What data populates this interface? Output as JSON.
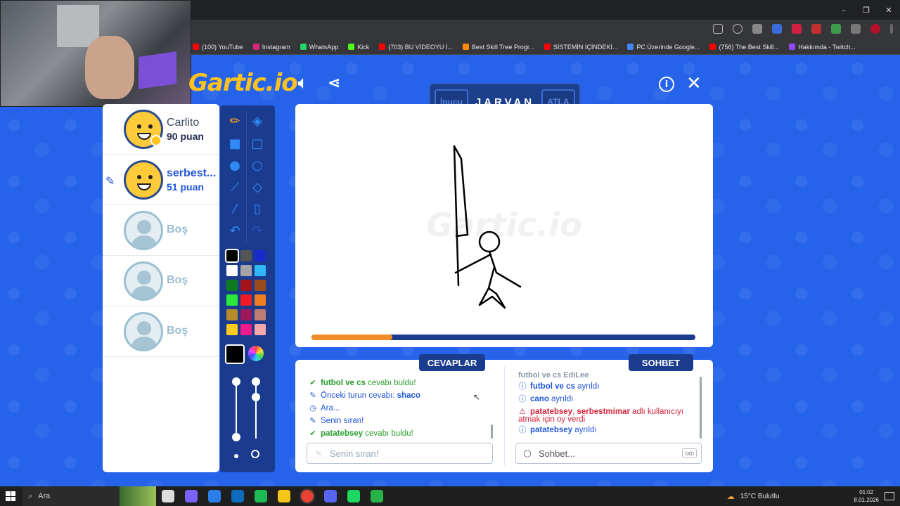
{
  "browser": {
    "window_controls": [
      "–",
      "❐",
      "✕"
    ],
    "bookmarks": [
      {
        "label": "(100) YouTube",
        "color": "#ff0000"
      },
      {
        "label": "Instagram",
        "color": "#d62976"
      },
      {
        "label": "WhatsApp",
        "color": "#25d366"
      },
      {
        "label": "Kick",
        "color": "#53fc18"
      },
      {
        "label": "(703) BU VİDEOYU İ...",
        "color": "#ff0000"
      },
      {
        "label": "Best Skill Tree Progr...",
        "color": "#ff8a00"
      },
      {
        "label": "SİSTEMİN İÇİNDEKİ...",
        "color": "#ff0000"
      },
      {
        "label": "PC Üzerinde Google...",
        "color": "#4285f4"
      },
      {
        "label": "(756) The Best Skill...",
        "color": "#ff0000"
      },
      {
        "label": "Hakkımda - Twitch...",
        "color": "#9146ff"
      }
    ]
  },
  "game": {
    "logo": "Gartic.io",
    "word_panel": {
      "hint_label": "İpucu",
      "word": "JARVAN",
      "skip_label": "ATLA"
    },
    "players": [
      {
        "name": "Carlito",
        "score": "90 puan",
        "active": false
      },
      {
        "name": "serbest...",
        "score": "51 puan",
        "active": true
      },
      {
        "name": "Boş"
      },
      {
        "name": "Boş"
      },
      {
        "name": "Boş"
      }
    ],
    "colors": [
      "#000000",
      "#555555",
      "#1a2bcc",
      "#ffffff",
      "#a5a5a5",
      "#2fb7f5",
      "#0e7a1e",
      "#a31319",
      "#9b4a1c",
      "#2be83b",
      "#ee1c24",
      "#ef7d21",
      "#b88a2b",
      "#a0165b",
      "#bd7d73",
      "#ffcb1f",
      "#f01a8c",
      "#f7a9a9"
    ],
    "selected_color": "#000000",
    "round_progress": 0.21,
    "answers": {
      "tab_label": "CEVAPLAR",
      "messages": [
        {
          "icon": "check-icon",
          "bold": "futbol ve cs",
          "text": " cevabı buldu!",
          "type": "green"
        },
        {
          "icon": "pencil-icon",
          "bold": "",
          "text": "Önceki turun cevabı: ",
          "tail": "shaco",
          "type": "blue"
        },
        {
          "icon": "clock-icon",
          "bold": "",
          "text": "Ara...",
          "type": "blue"
        },
        {
          "icon": "pencil-icon",
          "bold": "",
          "text": "Senin sıran!",
          "type": "blue"
        },
        {
          "icon": "check-icon",
          "bold": "patatebsey",
          "text": " cevabı buldu!",
          "type": "green"
        }
      ],
      "input_placeholder": "Senin sıran!"
    },
    "chat": {
      "tab_label": "SOHBET",
      "partial_line": "futbol ve cs EdiLee",
      "messages": [
        {
          "icon": "info-icon",
          "bold": "futbol ve cs",
          "text": " ayrıldı",
          "type": "blue"
        },
        {
          "icon": "info-icon",
          "bold": "cano",
          "text": " ayrıldı",
          "type": "blue"
        },
        {
          "icon": "warning-icon",
          "bold": "patatebsey",
          "text": ", ",
          "bold2": "serbestmimar",
          "text2": " adlı kullanıcıyı",
          "line2": "atmak için oy verdi",
          "type": "red"
        },
        {
          "icon": "info-icon",
          "bold": "patatebsey",
          "text": " ayrıldı",
          "type": "blue"
        }
      ],
      "input_placeholder": "Sohbet...",
      "tab_key": "tab"
    }
  },
  "taskbar": {
    "search_label": "Ara",
    "weather": "15°C  Bulutlu",
    "time": "01:02",
    "date": "8.01.2026",
    "apps": [
      {
        "name": "task-view",
        "color": "#dddddd"
      },
      {
        "name": "copilot",
        "color": "#7b61ff"
      },
      {
        "name": "store",
        "color": "#2b7de9"
      },
      {
        "name": "outlook",
        "color": "#0f6cbd"
      },
      {
        "name": "xbox",
        "color": "#1db954"
      },
      {
        "name": "file-explorer",
        "color": "#f5c518"
      },
      {
        "name": "chrome",
        "color": "#e94235"
      },
      {
        "name": "discord",
        "color": "#5865f2"
      },
      {
        "name": "spotify",
        "color": "#1ed760"
      },
      {
        "name": "app-green",
        "color": "#26b34a"
      }
    ]
  }
}
